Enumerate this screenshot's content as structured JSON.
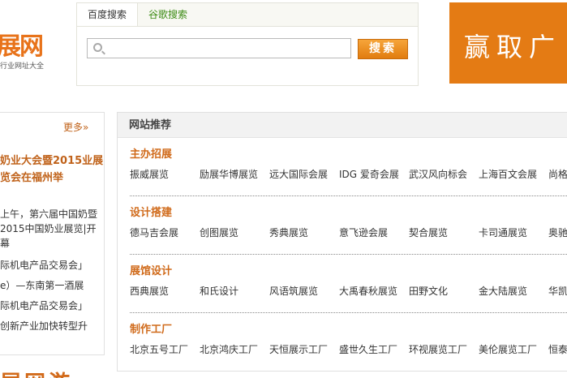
{
  "logo": {
    "mark": "展网",
    "subtitle": "行业网址大全"
  },
  "search": {
    "tabs": [
      "百度搜索",
      "谷歌搜索"
    ],
    "placeholder": "",
    "button_label": "搜索"
  },
  "ad": {
    "text": "赢取广"
  },
  "left_panel": {
    "more_label": "更多»",
    "headline": "奶业大会暨2015业展览会在福州举",
    "summary": "上午，第六届中国奶暨2015中国奶业展览|开幕",
    "items": [
      "际机电产品交易会」",
      "e）—东南第一酒展",
      "际机电产品交易会」",
      "创新产业加快转型升"
    ],
    "bottom_text": "展网游"
  },
  "main_panel": {
    "title": "网站推荐",
    "categories": [
      {
        "title": "主办招展",
        "links": [
          "振威展览",
          "励展华博展览",
          "远大国际会展",
          "IDG 爱奇会展",
          "武汉风向标会",
          "上海百文会展",
          "尚格"
        ]
      },
      {
        "title": "设计搭建",
        "links": [
          "德马吉会展",
          "创图展览",
          "秀典展览",
          "意飞逊会展",
          "契合展览",
          "卡司通展览",
          "奥驰"
        ]
      },
      {
        "title": "展馆设计",
        "links": [
          "西典展览",
          "和氏设计",
          "风语筑展览",
          "大禹春秋展览",
          "田野文化",
          "金大陆展览",
          "华凯"
        ]
      },
      {
        "title": "制作工厂",
        "links": [
          "北京五号工厂",
          "北京鸿庆工厂",
          "天恒展示工厂",
          "盛世久生工厂",
          "环视展览工厂",
          "美伦展览工厂",
          "恒泰"
        ]
      }
    ]
  },
  "colors": {
    "accent": "#d06a1a",
    "tab_green": "#3a8a12",
    "ad_bg": "#e47b14"
  }
}
